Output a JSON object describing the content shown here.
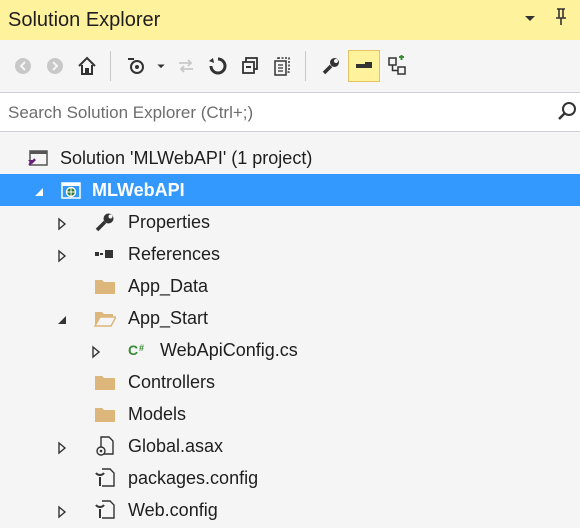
{
  "panel": {
    "title": "Solution Explorer",
    "dropdown_icon": "dropdown-arrow-icon",
    "pin_icon": "pin-icon"
  },
  "toolbar": {
    "buttons": [
      "back-icon",
      "forward-icon",
      "home-icon",
      "pending-changes-filter-icon",
      "dropdown-arrow-icon",
      "sync-with-active-document-icon",
      "refresh-icon",
      "collapse-all-icon",
      "show-all-files-icon",
      "properties-icon",
      "preview-selected-items-icon",
      "class-view-icon"
    ]
  },
  "search": {
    "placeholder": "Search Solution Explorer (Ctrl+;)"
  },
  "tree": {
    "solution": "Solution 'MLWebAPI' (1 project)",
    "project": "MLWebAPI",
    "properties": "Properties",
    "references": "References",
    "app_data": "App_Data",
    "app_start": "App_Start",
    "webapiconfig": "WebApiConfig.cs",
    "controllers": "Controllers",
    "models": "Models",
    "global": "Global.asax",
    "packages": "packages.config",
    "webconfig": "Web.config"
  },
  "colors": {
    "title_bg": "#fff29d",
    "selection": "#3399ff",
    "folder": "#dcb67a",
    "csharp": "#388a34"
  }
}
